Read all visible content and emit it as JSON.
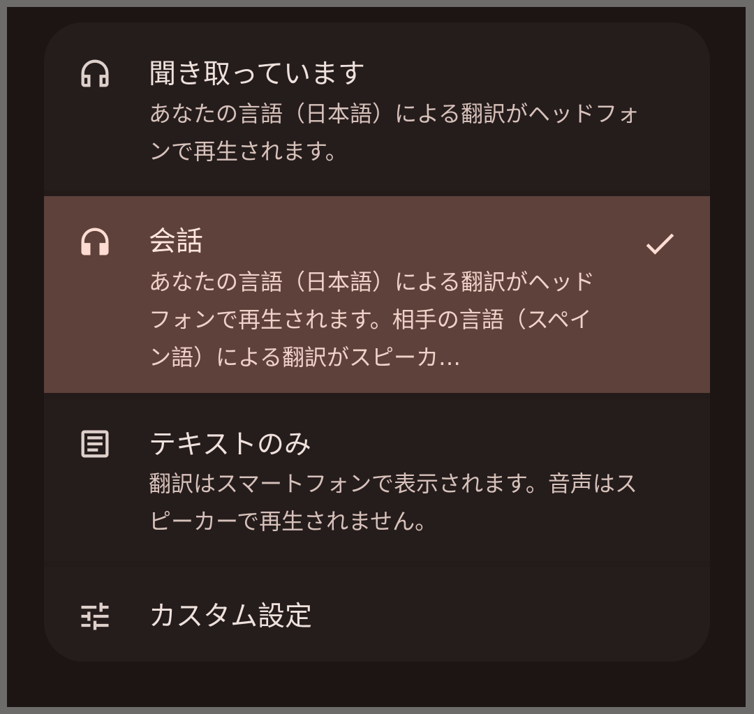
{
  "options": [
    {
      "title": "聞き取っています",
      "description": "あなたの言語（日本語）による翻訳がヘッドフォンで再生されます。",
      "icon": "headphones-icon",
      "selected": false
    },
    {
      "title": "会話",
      "description": "あなたの言語（日本語）による翻訳がヘッドフォンで再生されます。相手の言語（スペイン語）による翻訳がスピーカ…",
      "icon": "headphones-icon",
      "selected": true
    },
    {
      "title": "テキストのみ",
      "description": "翻訳はスマートフォンで表示されます。音声はスピーカーで再生されません。",
      "icon": "document-icon",
      "selected": false
    },
    {
      "title": "カスタム設定",
      "icon": "tune-sliders-icon",
      "selected": false
    }
  ],
  "colors": {
    "background": "#1c1514",
    "card": "#231b1a",
    "selected_row": "#5e413a",
    "text_primary": "#efe1dc",
    "text_secondary": "#d7c1bb",
    "icon": "#ded0cb",
    "icon_selected": "#ffdcd3"
  }
}
